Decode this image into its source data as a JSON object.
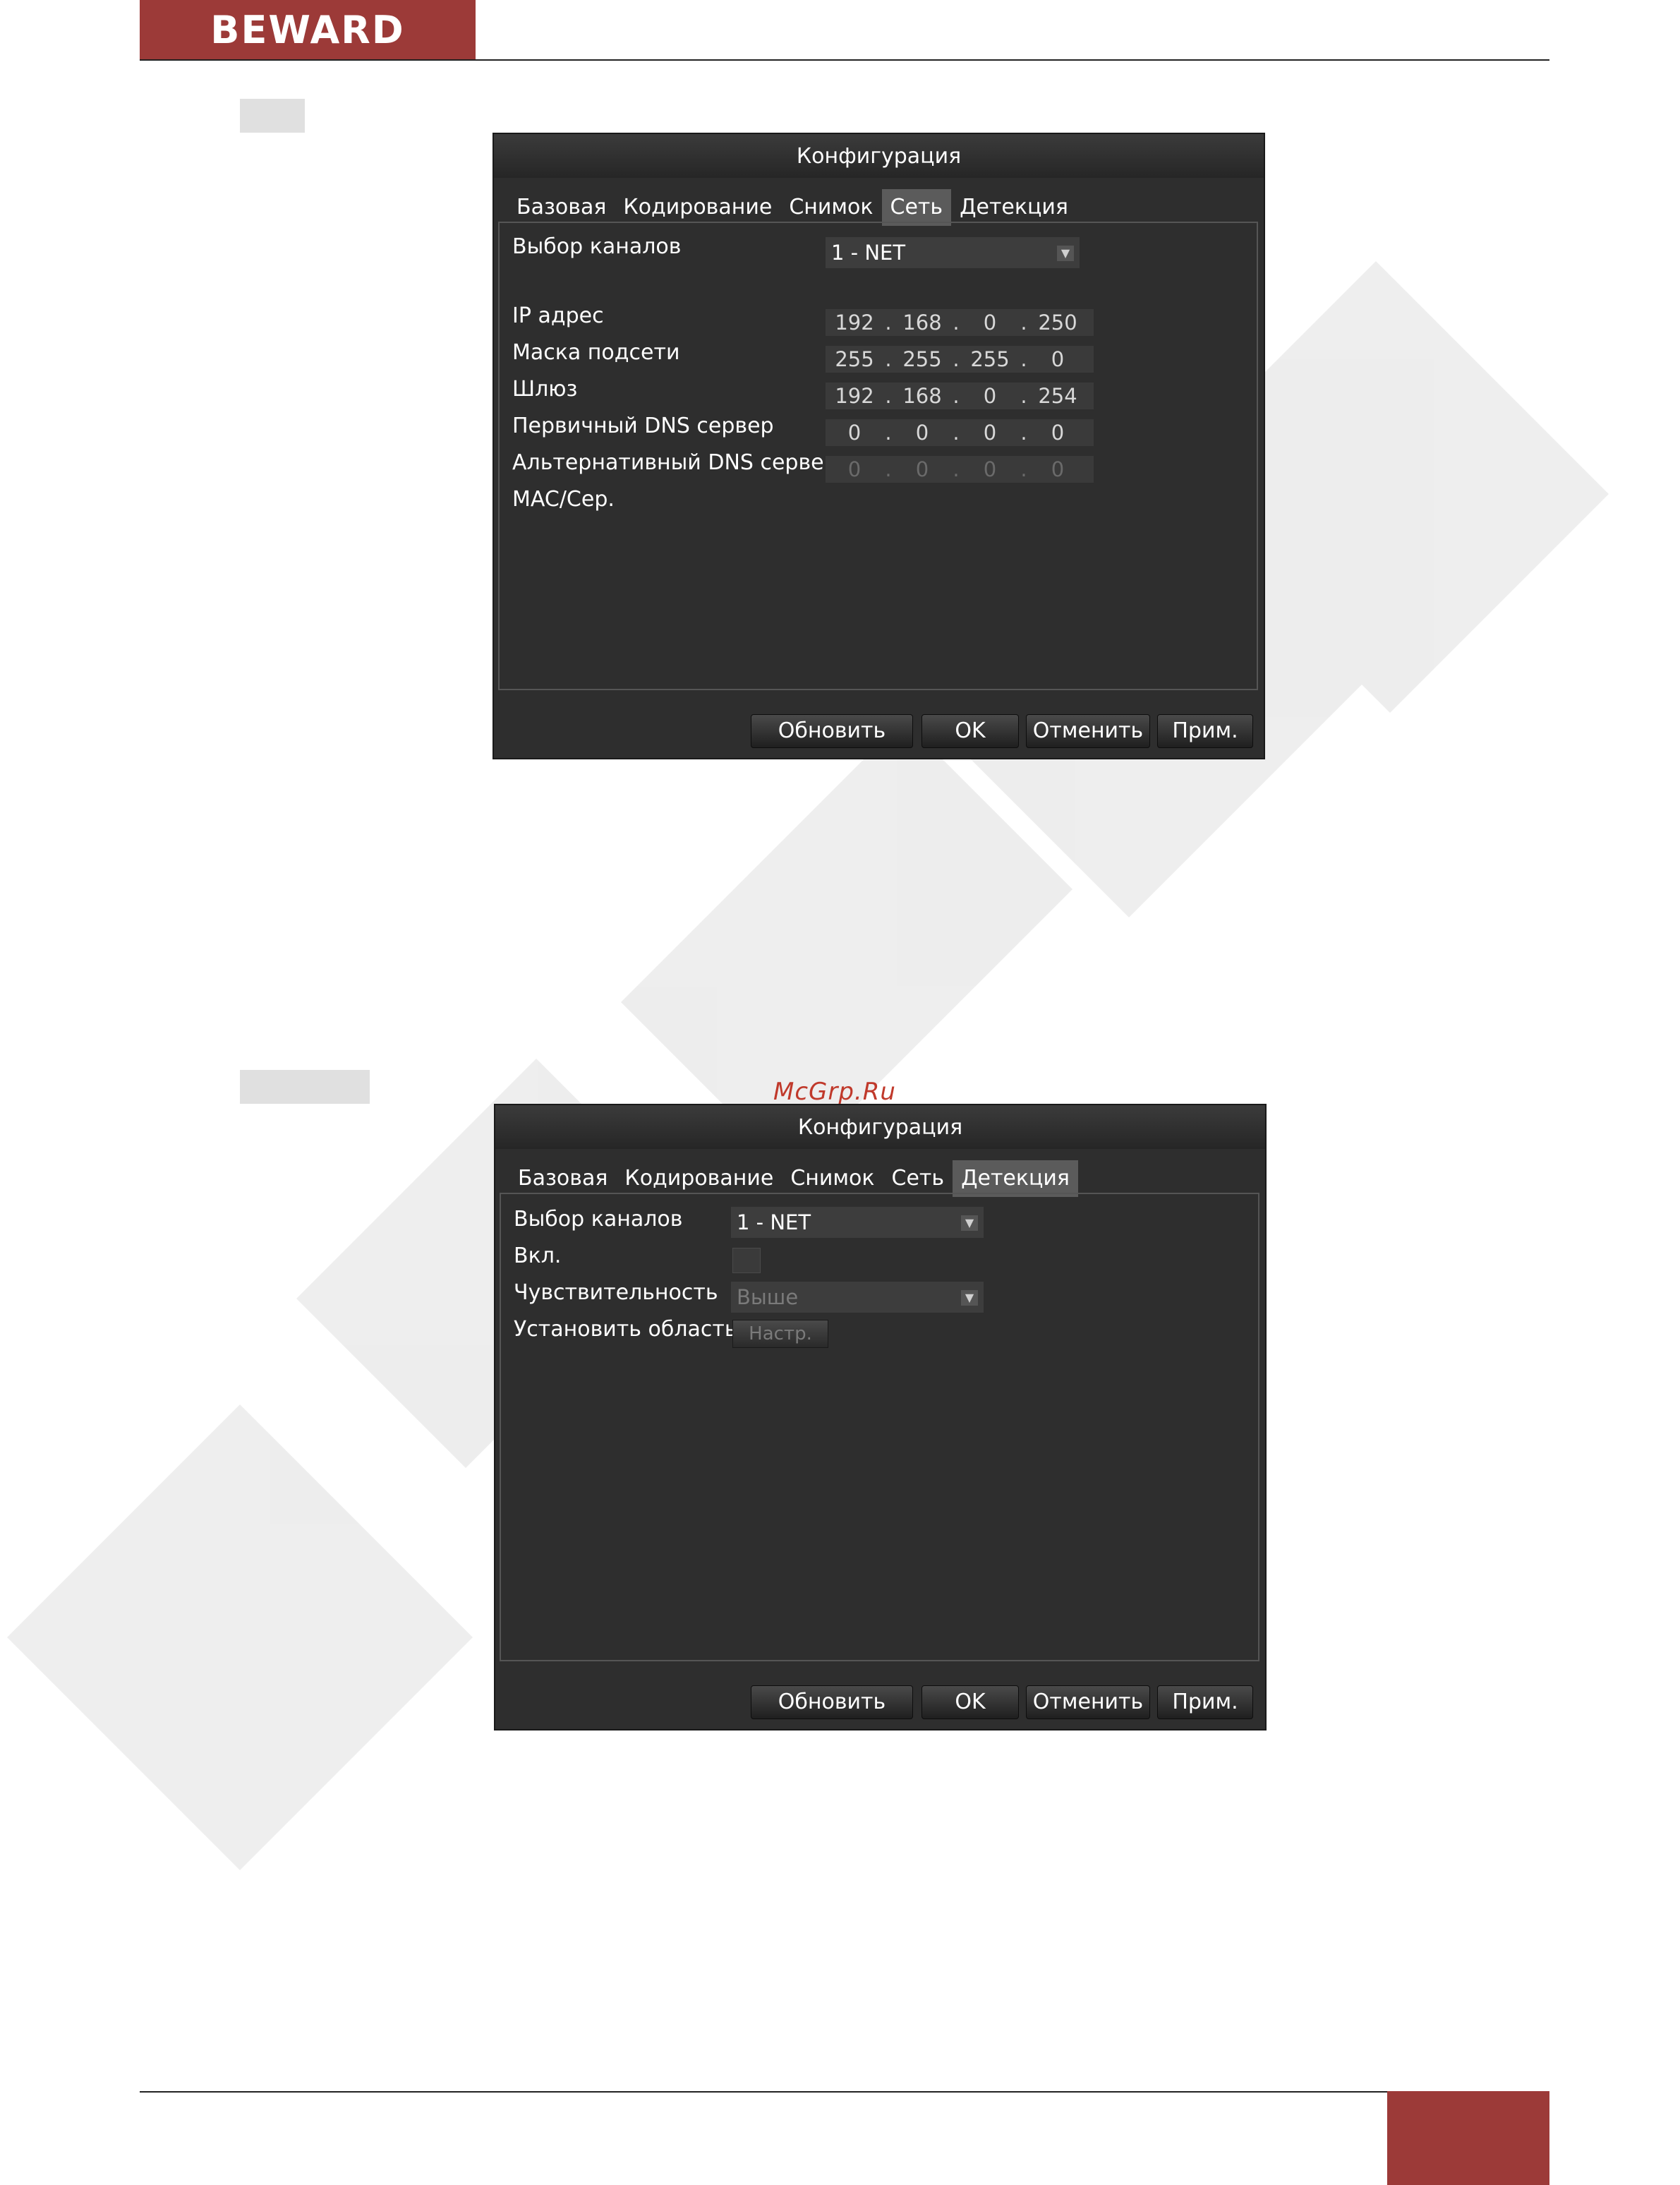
{
  "brand": {
    "logo": "BEWARD"
  },
  "watermark_link": "McGrp.Ru",
  "dialog_network": {
    "title": "Конфигурация",
    "tabs": [
      "Базовая",
      "Кодирование",
      "Снимок",
      "Сеть",
      "Детекция"
    ],
    "active_tab": "Сеть",
    "fields": {
      "channel_label": "Выбор каналов",
      "channel_value": "1 - NET",
      "ip_label": "IP адрес",
      "ip": [
        "192",
        "168",
        "0",
        "250"
      ],
      "mask_label": "Маска подсети",
      "mask": [
        "255",
        "255",
        "255",
        "0"
      ],
      "gateway_label": "Шлюз",
      "gateway": [
        "192",
        "168",
        "0",
        "254"
      ],
      "dns1_label": "Первичный DNS сервер",
      "dns1": [
        "0",
        "0",
        "0",
        "0"
      ],
      "dns2_label": "Альтернативный DNS сервер",
      "dns2": [
        "0",
        "0",
        "0",
        "0"
      ],
      "mac_label": "MAC/Сер."
    },
    "buttons": {
      "refresh": "Обновить",
      "ok": "OK",
      "cancel": "Отменить",
      "apply": "Прим."
    }
  },
  "dialog_detect": {
    "title": "Конфигурация",
    "tabs": [
      "Базовая",
      "Кодирование",
      "Снимок",
      "Сеть",
      "Детекция"
    ],
    "active_tab": "Детекция",
    "fields": {
      "channel_label": "Выбор каналов",
      "channel_value": "1 - NET",
      "enable_label": "Вкл.",
      "enable_checked": false,
      "sensitivity_label": "Чувствительность",
      "sensitivity_value": "Выше",
      "area_label": "Установить область",
      "area_button": "Настр."
    },
    "buttons": {
      "refresh": "Обновить",
      "ok": "OK",
      "cancel": "Отменить",
      "apply": "Прим."
    }
  },
  "colors": {
    "brand_red": "#9c3a38",
    "window_bg": "#2e2e2e",
    "active_tab": "#5b5b5b",
    "link_red": "#c0392b"
  },
  "icons": {
    "dropdown_arrow": "chevron-down-icon"
  }
}
